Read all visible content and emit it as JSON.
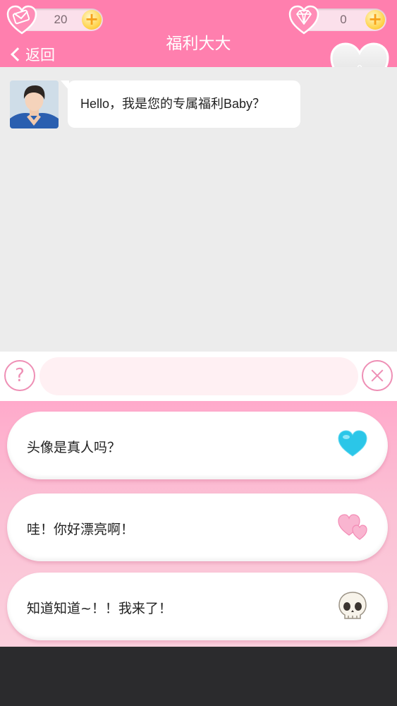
{
  "header": {
    "title": "福利大大",
    "back_label": "返回",
    "letters_count": "20",
    "gems_count": "0",
    "hearts_count": "0"
  },
  "chat": {
    "messages": [
      {
        "text": "Hello，我是您的专属福利Baby？"
      }
    ]
  },
  "input": {
    "help_label": "?",
    "value": "",
    "placeholder": ""
  },
  "options": [
    {
      "label": "头像是真人吗？",
      "icon": "blue-heart-icon"
    },
    {
      "label": "哇！你好漂亮啊！",
      "icon": "pink-hearts-icon"
    },
    {
      "label": "知道知道~！！我来了！",
      "icon": "skull-icon"
    }
  ],
  "colors": {
    "accent": "#ff7fae",
    "chat_bg": "#ececec",
    "bottom_bar": "#2b2b2d"
  }
}
